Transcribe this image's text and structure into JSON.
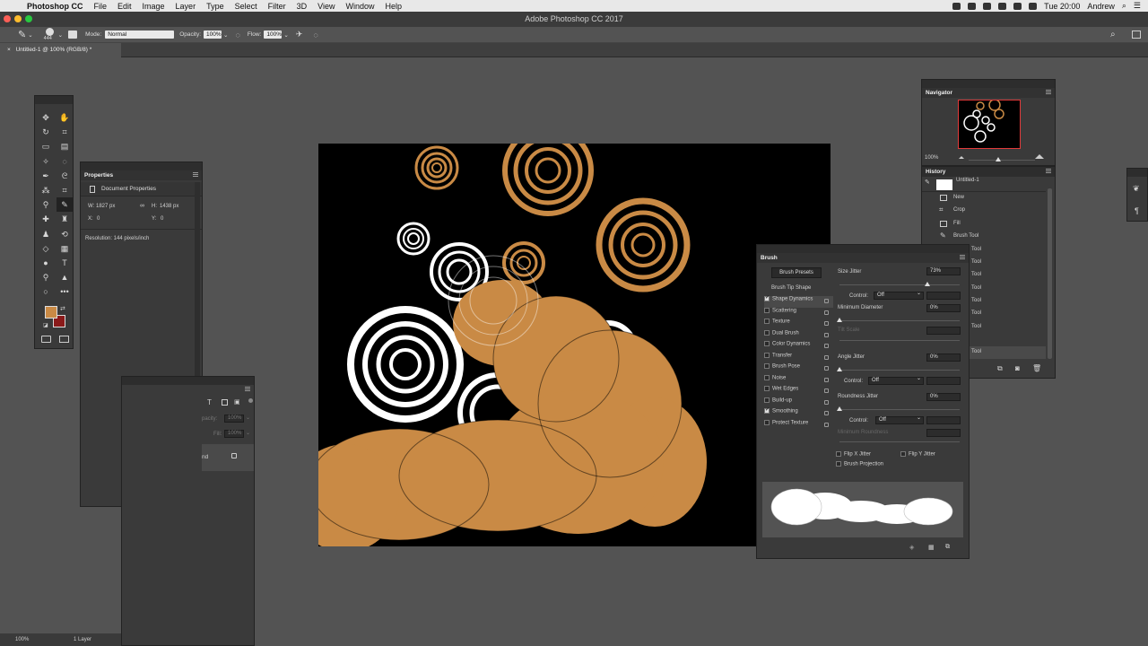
{
  "menubar": {
    "app_name": "Photoshop CC",
    "items": [
      "File",
      "Edit",
      "Image",
      "Layer",
      "Type",
      "Select",
      "Filter",
      "3D",
      "View",
      "Window",
      "Help"
    ],
    "clock": "Tue 20:00",
    "user": "Andrew"
  },
  "window": {
    "title": "Adobe Photoshop CC 2017"
  },
  "options_bar": {
    "brush_size": "444",
    "mode_label": "Mode:",
    "mode_value": "Normal",
    "opacity_label": "Opacity:",
    "opacity_value": "100%",
    "flow_label": "Flow:",
    "flow_value": "100%"
  },
  "document": {
    "tab_label": "Untitled-1 @ 100% (RGB/8) *"
  },
  "status": {
    "zoom": "100%",
    "layers": "1 Layer"
  },
  "properties": {
    "title": "Properties",
    "section": "Document Properties",
    "w_label": "W:",
    "w_value": "1827 px",
    "h_label": "H:",
    "h_value": "1438 px",
    "x_label": "X:",
    "x_value": "0",
    "y_label": "Y:",
    "y_value": "0",
    "resolution": "Resolution: 144 pixels/inch"
  },
  "layers_fragment": {
    "opacity_label": "pacity:",
    "opacity_value": "100%",
    "fill_label": "Fill:",
    "fill_value": "100%",
    "layer_suffix": "nd"
  },
  "navigator": {
    "title": "Navigator",
    "zoom": "100%"
  },
  "history": {
    "title": "History",
    "snapshot": "Untitled-1",
    "items": [
      "New",
      "Crop",
      "Fill",
      "Brush Tool",
      "Tool",
      "Tool",
      "Tool",
      "Tool",
      "Tool",
      "Tool",
      "Tool",
      "Tool"
    ]
  },
  "brush": {
    "title": "Brush",
    "presets_button": "Brush Presets",
    "tip_shape": "Brush Tip Shape",
    "options": [
      {
        "label": "Shape Dynamics",
        "checked": true
      },
      {
        "label": "Scattering",
        "checked": false
      },
      {
        "label": "Texture",
        "checked": false
      },
      {
        "label": "Dual Brush",
        "checked": false
      },
      {
        "label": "Color Dynamics",
        "checked": false
      },
      {
        "label": "Transfer",
        "checked": false
      },
      {
        "label": "Brush Pose",
        "checked": false
      },
      {
        "label": "Noise",
        "checked": false
      },
      {
        "label": "Wet Edges",
        "checked": false
      },
      {
        "label": "Build-up",
        "checked": false
      },
      {
        "label": "Smoothing",
        "checked": true
      },
      {
        "label": "Protect Texture",
        "checked": false
      }
    ],
    "size_jitter_label": "Size Jitter",
    "size_jitter_value": "73%",
    "size_jitter_level": 0.73,
    "control_label": "Control:",
    "control_value": "Off",
    "min_diameter_label": "Minimum Diameter",
    "min_diameter_value": "0%",
    "tilt_scale_label": "Tilt Scale",
    "angle_jitter_label": "Angle Jitter",
    "angle_jitter_value": "0%",
    "roundness_jitter_label": "Roundness Jitter",
    "roundness_jitter_value": "0%",
    "min_roundness_label": "Minimum Roundness",
    "flip_x": "Flip X Jitter",
    "flip_y": "Flip Y Jitter",
    "projection": "Brush Projection"
  },
  "colors": {
    "foreground": "#c98a45",
    "background": "#8a1a1a",
    "brush_paint": "#c98a45"
  }
}
